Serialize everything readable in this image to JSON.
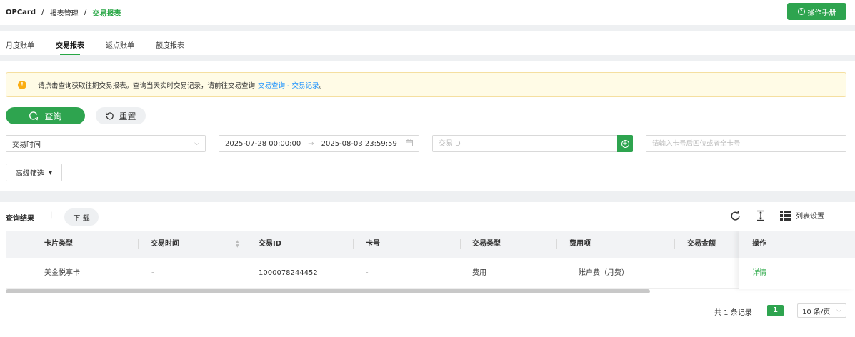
{
  "breadcrumb": {
    "root": "OPCard",
    "separator": "/",
    "middle": "报表管理",
    "current": "交易报表"
  },
  "header": {
    "manual_button": "操作手册"
  },
  "tabs": [
    {
      "label": "月度账单",
      "active": false
    },
    {
      "label": "交易报表",
      "active": true
    },
    {
      "label": "返点账单",
      "active": false
    },
    {
      "label": "额度报表",
      "active": false
    }
  ],
  "notice": {
    "text": "请点击查询获取往期交易报表。查询当天实时交易记录，请前往交易查询",
    "link": "交易查询 - 交易记录",
    "suffix": "。"
  },
  "actions": {
    "query": "查询",
    "reset": "重置"
  },
  "filters": {
    "time_type": "交易时间",
    "date_start": "2025-07-28 00:00:00",
    "date_arrow": "→",
    "date_end": "2025-08-03 23:59:59",
    "id_placeholder": "交易ID",
    "card_placeholder": "请输入卡号后四位或者全卡号",
    "advanced": "高级筛选"
  },
  "results": {
    "title": "查询结果",
    "separator": "|",
    "download": "下 载",
    "column_settings": "列表设置"
  },
  "table": {
    "columns": [
      "卡片类型",
      "交易时间",
      "交易ID",
      "卡号",
      "交易类型",
      "费用项",
      "交易金额"
    ],
    "action_column": "操作",
    "rows": [
      {
        "cells": [
          "美金悦享卡",
          "-",
          "1000078244452",
          "-",
          "费用",
          "账户费（月费）",
          ""
        ],
        "action": "详情"
      }
    ]
  },
  "pagination": {
    "total": "共 1 条记录",
    "current_page": "1",
    "page_size": "10 条/页"
  },
  "colors": {
    "primary": "#2ea44f",
    "link": "#1890ff",
    "warning": "#faad14",
    "notice_bg": "#fffbe6"
  }
}
